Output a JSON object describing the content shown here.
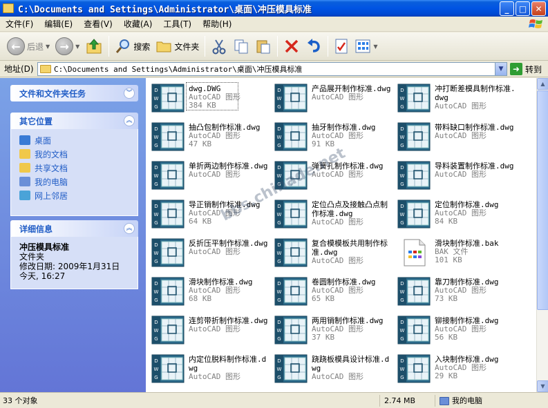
{
  "window": {
    "title": "C:\\Documents and Settings\\Administrator\\桌面\\冲压模具标准",
    "controls": {
      "minimize": "_",
      "maximize": "□",
      "close": "✕"
    }
  },
  "menu": [
    "文件(F)",
    "编辑(E)",
    "查看(V)",
    "收藏(A)",
    "工具(T)",
    "帮助(H)"
  ],
  "toolbar": {
    "back_label": "后退",
    "search_label": "搜索",
    "folders_label": "文件夹"
  },
  "address": {
    "label": "地址(D)",
    "value": "C:\\Documents and Settings\\Administrator\\桌面\\冲压模具标准",
    "go_label": "转到"
  },
  "tasks_panel": {
    "title": "文件和文件夹任务"
  },
  "places_panel": {
    "title": "其它位置",
    "items": [
      {
        "label": "桌面",
        "color": "#3a7bd5"
      },
      {
        "label": "我的文档",
        "color": "#f0c84a"
      },
      {
        "label": "共享文档",
        "color": "#f0c84a"
      },
      {
        "label": "我的电脑",
        "color": "#6a8fd8"
      },
      {
        "label": "网上邻居",
        "color": "#4aa3d8"
      }
    ]
  },
  "details_panel": {
    "title": "详细信息",
    "name": "冲压模具标准",
    "type": "文件夹",
    "modified": "修改日期: 2009年1月31日",
    "today": "今天, 16:27"
  },
  "files": [
    {
      "name": "dwg.DWG",
      "type": "AutoCAD 图形",
      "size": "384 KB",
      "icon": "dwg",
      "selected": true
    },
    {
      "name": "产品展开制作标准.dwg",
      "type": "AutoCAD 图形",
      "size": "",
      "icon": "dwg"
    },
    {
      "name": "冲打断差模具制作标准.dwg",
      "type": "AutoCAD 图形",
      "size": "",
      "icon": "dwg"
    },
    {
      "name": "抽凸包制作标准.dwg",
      "type": "AutoCAD 图形",
      "size": "47 KB",
      "icon": "dwg"
    },
    {
      "name": "抽牙制作标准.dwg",
      "type": "AutoCAD 图形",
      "size": "91 KB",
      "icon": "dwg"
    },
    {
      "name": "带料缺口制作标准.dwg",
      "type": "AutoCAD 图形",
      "size": "",
      "icon": "dwg"
    },
    {
      "name": "单折两边制作标准.dwg",
      "type": "AutoCAD 图形",
      "size": "",
      "icon": "dwg"
    },
    {
      "name": "弹簧孔制作标准.dwg",
      "type": "AutoCAD 图形",
      "size": "",
      "icon": "dwg"
    },
    {
      "name": "导料装置制作标准.dwg",
      "type": "AutoCAD 图形",
      "size": "",
      "icon": "dwg"
    },
    {
      "name": "导正销制作标准.dwg",
      "type": "AutoCAD 图形",
      "size": "64 KB",
      "icon": "dwg"
    },
    {
      "name": "定位凸点及接触凸点制作标准.dwg",
      "type": "AutoCAD 图形",
      "size": "",
      "icon": "dwg"
    },
    {
      "name": "定位制作标准.dwg",
      "type": "AutoCAD 图形",
      "size": "84 KB",
      "icon": "dwg"
    },
    {
      "name": "反折压平制作标准.dwg",
      "type": "AutoCAD 图形",
      "size": "",
      "icon": "dwg"
    },
    {
      "name": "复合模模板共用制作标准.dwg",
      "type": "AutoCAD 图形",
      "size": "",
      "icon": "dwg"
    },
    {
      "name": "滑块制作标准.bak",
      "type": "BAK 文件",
      "size": "101 KB",
      "icon": "bak"
    },
    {
      "name": "滑块制作标准.dwg",
      "type": "AutoCAD 图形",
      "size": "68 KB",
      "icon": "dwg"
    },
    {
      "name": "卷圆制作标准.dwg",
      "type": "AutoCAD 图形",
      "size": "65 KB",
      "icon": "dwg"
    },
    {
      "name": "靠刀制作标准.dwg",
      "type": "AutoCAD 图形",
      "size": "73 KB",
      "icon": "dwg"
    },
    {
      "name": "连剪带折制作标准.dwg",
      "type": "AutoCAD 图形",
      "size": "",
      "icon": "dwg"
    },
    {
      "name": "两用销制作标准.dwg",
      "type": "AutoCAD 图形",
      "size": "37 KB",
      "icon": "dwg"
    },
    {
      "name": "铆接制作标准.dwg",
      "type": "AutoCAD 图形",
      "size": "56 KB",
      "icon": "dwg"
    },
    {
      "name": "内定位脱料制作标准.dwg",
      "type": "AutoCAD 图形",
      "size": "",
      "icon": "dwg"
    },
    {
      "name": "跷跷板模具设计标准.dwg",
      "type": "AutoCAD 图形",
      "size": "",
      "icon": "dwg"
    },
    {
      "name": "入块制作标准.dwg",
      "type": "AutoCAD 图形",
      "size": "29 KB",
      "icon": "dwg"
    }
  ],
  "status": {
    "count": "33 个对象",
    "size": "2.74 MB",
    "location": "我的电脑"
  },
  "watermark": "bbs.chinade.net"
}
